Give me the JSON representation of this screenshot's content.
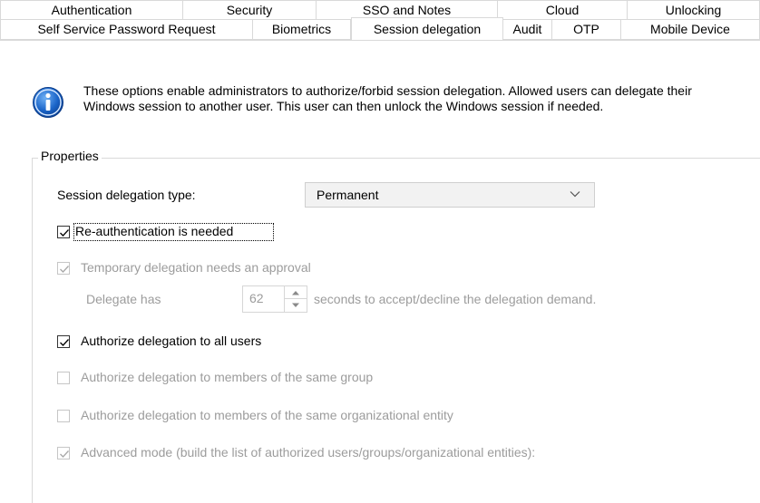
{
  "tabs_row1": [
    "Authentication",
    "Security",
    "SSO and Notes",
    "Cloud",
    "Unlocking"
  ],
  "tabs_row2": [
    "Self Service Password Request",
    "Biometrics",
    "Session delegation",
    "Audit",
    "OTP",
    "Mobile Device"
  ],
  "active_tab": "Session delegation",
  "info_text": "These options enable administrators to authorize/forbid session delegation. Allowed users can delegate their Windows session to another user. This user can then unlock the Windows session if needed.",
  "properties": {
    "legend": "Properties",
    "delegation_type_label": "Session delegation type:",
    "delegation_type_value": "Permanent",
    "reauth_label": "Re-authentication is needed",
    "reauth_checked": true,
    "temp_approval_label": "Temporary delegation needs an approval",
    "temp_approval_checked": true,
    "delegate_has_label": "Delegate has",
    "delegate_seconds": "62",
    "seconds_suffix": "seconds to accept/decline the delegation demand.",
    "authorize_all_label": "Authorize delegation to all users",
    "authorize_all_checked": true,
    "same_group_label": "Authorize delegation to members of the same group",
    "same_group_checked": false,
    "same_entity_label": "Authorize delegation to members of the same organizational entity",
    "same_entity_checked": false,
    "advanced_label": "Advanced mode (build the list of authorized users/groups/organizational entities):",
    "advanced_checked": true
  },
  "colors": {
    "disabled_text": "#9c9c9c",
    "border": "#d9d9d9",
    "info_icon_blue": "#1a64c8"
  },
  "icons": [
    "info-icon",
    "chevron-down-icon",
    "checkmark-icon",
    "spin-up-icon",
    "spin-down-icon"
  ]
}
